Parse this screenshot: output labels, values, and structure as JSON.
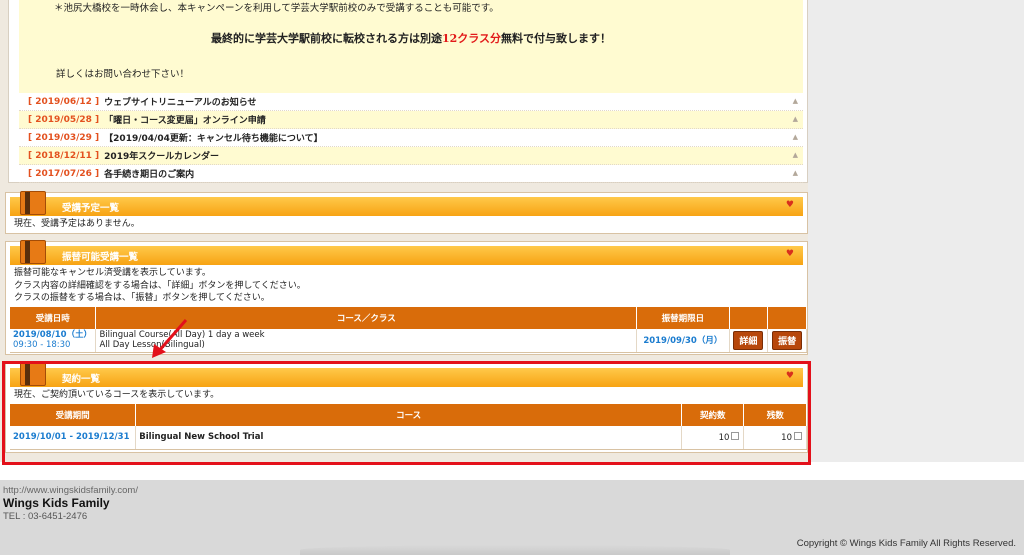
{
  "notice": {
    "line1": "＊池尻大橋校を一時休会し、本キャンペーンを利用して学芸大学駅前校のみで受講することも可能です。",
    "line2_prefix": "最終的に学芸大学駅前校に転校される方は別途",
    "line2_highlight": "12クラス分",
    "line2_suffix": "無料で付与致します！",
    "line3": "詳しくはお問い合わせ下さい！"
  },
  "news": [
    {
      "date": "[ 2019/06/12 ]",
      "title": "ウェブサイトリニューアルのお知らせ"
    },
    {
      "date": "[ 2019/05/28 ]",
      "title": "「曜日・コース変更届」オンライン申請"
    },
    {
      "date": "[ 2019/03/29 ]",
      "title": "【2019/04/04更新：キャンセル待ち機能について】"
    },
    {
      "date": "[ 2018/12/11 ]",
      "title": "2019年スクールカレンダー"
    },
    {
      "date": "[ 2017/07/26 ]",
      "title": "各手続き期日のご案内"
    }
  ],
  "scheduled": {
    "title": "受講予定一覧",
    "text": "現在、受講予定はありません。"
  },
  "transfer": {
    "title": "振替可能受講一覧",
    "desc1": "振替可能なキャンセル済受講を表示しています。",
    "desc2": "クラス内容の詳細確認をする場合は、「詳細」ボタンを押してください。",
    "desc3": "クラスの振替をする場合は、「振替」ボタンを押してください。",
    "headers": {
      "date": "受講日時",
      "course": "コース／クラス",
      "deadline": "振替期限日"
    },
    "row": {
      "date": "2019/08/10（土）",
      "time": "09:30 - 18:30",
      "course": "Bilingual Course(All Day) 1 day a week",
      "class": "All Day Lesson(Bilingual)",
      "deadline": "2019/09/30（月）",
      "detail_btn": "詳細",
      "transfer_btn": "振替"
    }
  },
  "contract": {
    "title": "契約一覧",
    "text": "現在、ご契約頂いているコースを表示しています。",
    "headers": {
      "period": "受講期間",
      "course": "コース",
      "count": "契約数",
      "remaining": "残数"
    },
    "row": {
      "period": "2019/10/01 - 2019/12/31",
      "course": "Bilingual New School Trial",
      "count": "10",
      "remaining": "10"
    }
  },
  "footer": {
    "url": "http://www.wingskidsfamily.com/",
    "name": "Wings Kids Family",
    "tel": "TEL : 03-6451-2476",
    "copyright": "Copyright © Wings Kids Family All Rights Reserved."
  },
  "colors": {
    "accent_orange": "#f7a313",
    "header_brown": "#d96c0a",
    "date_orange": "#e3511f",
    "highlight_red": "#e3101a"
  }
}
